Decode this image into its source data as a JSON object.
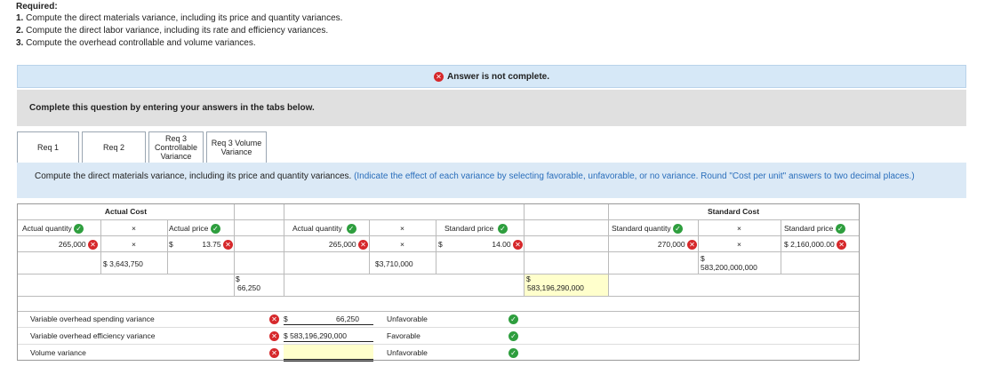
{
  "required": {
    "title": "Required:",
    "items": [
      {
        "num": "1.",
        "text": "Compute the direct materials variance, including its price and quantity variances."
      },
      {
        "num": "2.",
        "text": "Compute the direct labor variance, including its rate and efficiency variances."
      },
      {
        "num": "3.",
        "text": "Compute the overhead controllable and volume variances."
      }
    ]
  },
  "status": {
    "text": "Answer is not complete."
  },
  "instruction": "Complete this question by entering your answers in the tabs below.",
  "tabs": [
    {
      "label": "Req 1"
    },
    {
      "label": "Req 2"
    },
    {
      "label": "Req 3 Controllable Variance"
    },
    {
      "label": "Req 3 Volume Variance"
    }
  ],
  "description": {
    "main": "Compute the direct materials variance, including its price and quantity variances.",
    "note": "(Indicate the effect of each variance by selecting favorable, unfavorable, or no variance. Round \"Cost per unit\" answers to two decimal places.)"
  },
  "table": {
    "actual_cost_header": "Actual Cost",
    "standard_cost_header": "Standard Cost",
    "col_actual_quantity": "Actual quantity",
    "col_actual_price": "Actual price",
    "col_standard_price": "Standard price",
    "col_standard_quantity": "Standard quantity",
    "times": "×",
    "dollar": "$",
    "ac_qty": "265,000",
    "ac_price": "13.75",
    "ac_total": "$ 3,643,750",
    "mid_qty": "265,000",
    "mid_std_price": "14.00",
    "mid_total": "$3,710,000",
    "sc_qty": "270,000",
    "sc_price": "$ 2,160,000.00",
    "sc_total": "583,200,000,000",
    "price_variance": "66,250",
    "quantity_variance": "583,196,290,000"
  },
  "summary": [
    {
      "label": "Variable overhead spending variance",
      "amount": "66,250",
      "prefix": "$",
      "effect": "Unfavorable"
    },
    {
      "label": "Variable overhead efficiency variance",
      "amount": "583,196,290,000",
      "prefix": "$",
      "effect": "Favorable"
    },
    {
      "label": "Volume variance",
      "amount": "",
      "prefix": "",
      "effect": "Unfavorable"
    }
  ],
  "colors": {
    "error": "#d6282b",
    "ok": "#2e9e3e",
    "status_bg": "#d6e8f7",
    "note": "#2a6ebb"
  }
}
